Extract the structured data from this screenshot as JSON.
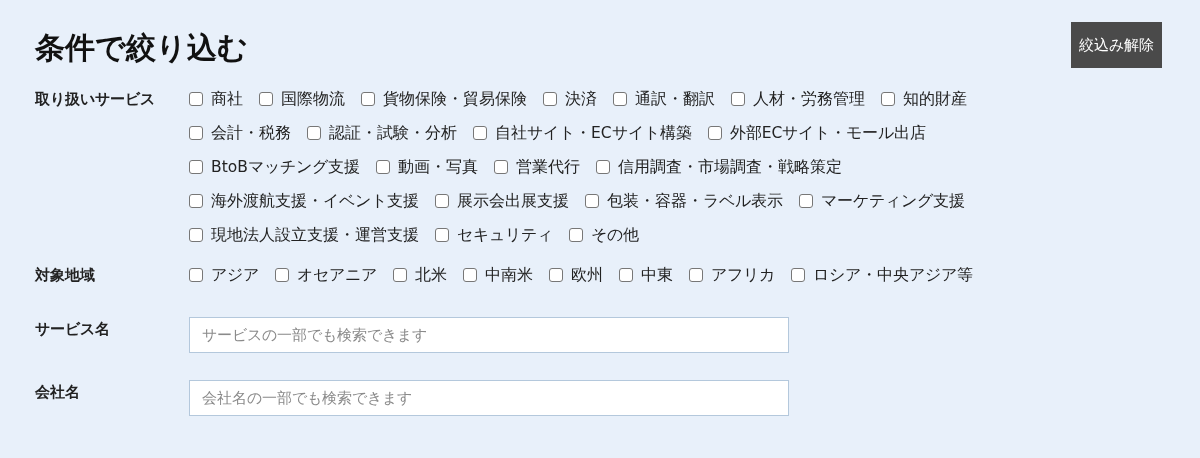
{
  "title": "条件で絞り込む",
  "clear_button": "絞込み解除",
  "filters": [
    {
      "label": "取り扱いサービス",
      "rows": [
        [
          {
            "label": "商社",
            "checked": false
          },
          {
            "label": "国際物流",
            "checked": false
          },
          {
            "label": "貨物保険・貿易保険",
            "checked": false
          },
          {
            "label": "決済",
            "checked": false
          },
          {
            "label": "通訳・翻訳",
            "checked": false
          },
          {
            "label": "人材・労務管理",
            "checked": false
          },
          {
            "label": "知的財産",
            "checked": false
          }
        ],
        [
          {
            "label": "会計・税務",
            "checked": false
          },
          {
            "label": "認証・試験・分析",
            "checked": false
          },
          {
            "label": "自社サイト・ECサイト構築",
            "checked": false
          },
          {
            "label": "外部ECサイト・モール出店",
            "checked": false
          }
        ],
        [
          {
            "label": "BtoBマッチング支援",
            "checked": false
          },
          {
            "label": "動画・写真",
            "checked": false
          },
          {
            "label": "営業代行",
            "checked": false
          },
          {
            "label": "信用調査・市場調査・戦略策定",
            "checked": false
          }
        ],
        [
          {
            "label": "海外渡航支援・イベント支援",
            "checked": false
          },
          {
            "label": "展示会出展支援",
            "checked": false
          },
          {
            "label": "包装・容器・ラベル表示",
            "checked": false
          },
          {
            "label": "マーケティング支援",
            "checked": false
          }
        ],
        [
          {
            "label": "現地法人設立支援・運営支援",
            "checked": false
          },
          {
            "label": "セキュリティ",
            "checked": false
          },
          {
            "label": "その他",
            "checked": false
          }
        ]
      ]
    },
    {
      "label": "対象地域",
      "rows": [
        [
          {
            "label": "アジア",
            "checked": false
          },
          {
            "label": "オセアニア",
            "checked": false
          },
          {
            "label": "北米",
            "checked": false
          },
          {
            "label": "中南米",
            "checked": false
          },
          {
            "label": "欧州",
            "checked": false
          },
          {
            "label": "中東",
            "checked": false
          },
          {
            "label": "アフリカ",
            "checked": false
          },
          {
            "label": "ロシア・中央アジア等",
            "checked": false
          }
        ]
      ]
    }
  ],
  "fields": [
    {
      "label": "サービス名",
      "placeholder": "サービスの一部でも検索できます"
    },
    {
      "label": "会社名",
      "placeholder": "会社名の一部でも検索できます"
    }
  ]
}
